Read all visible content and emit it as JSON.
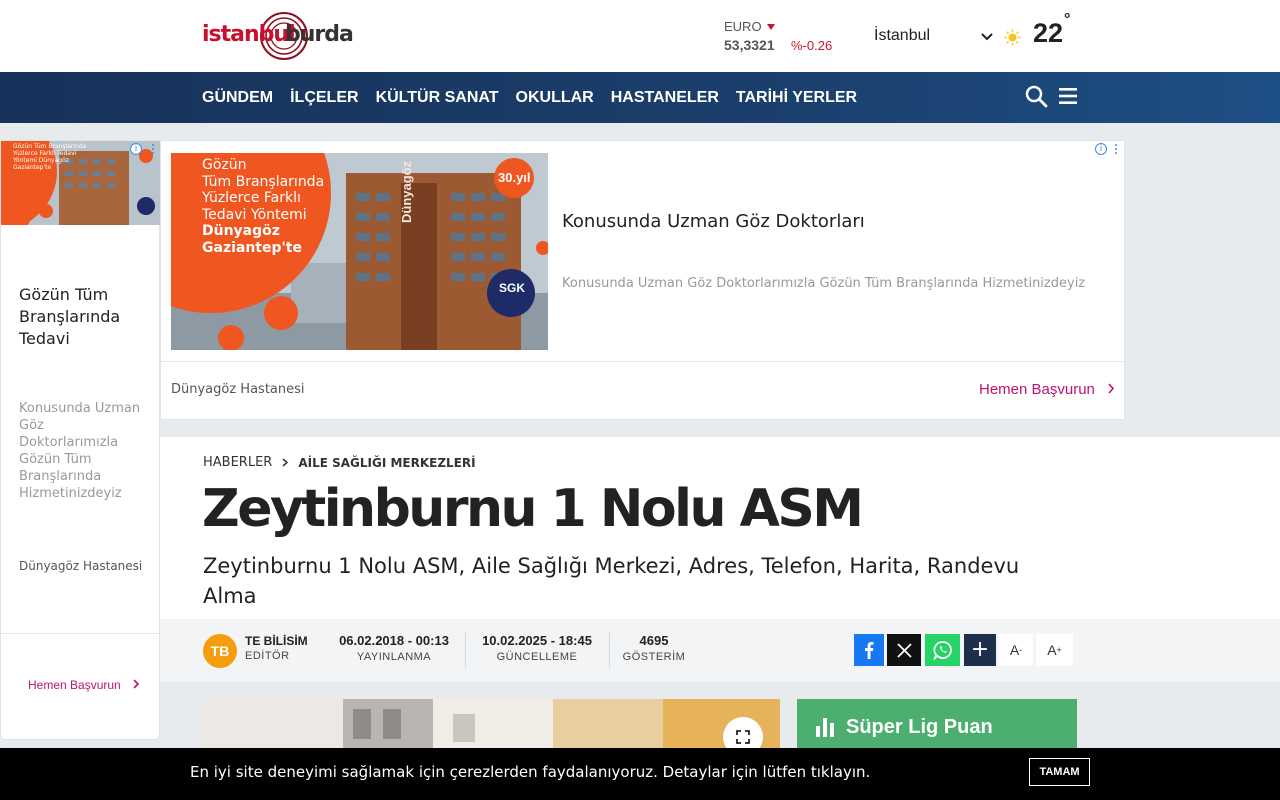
{
  "header": {
    "logo_part1": "istanbul",
    "logo_part2": "burda",
    "currency": {
      "name": "EURO",
      "value": "53,3321",
      "change": "%-0.26",
      "trend": "down"
    },
    "city": "İstanbul",
    "weather_icon": "sun-icon",
    "temperature": "22",
    "degree": "°"
  },
  "nav": {
    "items": [
      "GÜNDEM",
      "İLÇELER",
      "KÜLTÜR SANAT",
      "OKULLAR",
      "HASTANELER",
      "TARİHİ YERLER"
    ],
    "search_icon": "search-icon",
    "menu_icon": "hamburger-menu-icon"
  },
  "side_ad": {
    "title": "Gözün Tüm Branşlarında Tedavi",
    "description": "Konusunda Uzman Göz Doktorlarımızla Gözün Tüm Branşlarında Hizmetinizdeyiz",
    "advertiser": "Dünyagöz Hastanesi",
    "cta": "Hemen Başvurun",
    "image_text": "Gözün Tüm Branşlarında Yüzlerce Farklı Tedavi Yöntemi Dünyagöz Gaziantep'te"
  },
  "banner_ad": {
    "image_lines": [
      "Gözün",
      "Tüm Branşlarında",
      "Yüzlerce Farklı",
      "Tedavi Yöntemi",
      "Dünyagöz",
      "Gaziantep'te"
    ],
    "badge": "30.yıl",
    "sgk_badge": "SGK",
    "building_sign": "Dünyagöz",
    "title": "Konusunda Uzman Göz Doktorları",
    "description": "Konusunda Uzman Göz Doktorlarımızla Gözün Tüm Branşlarında Hizmetinizdeyiz",
    "advertiser": "Dünyagöz Hastanesi",
    "cta": "Hemen Başvurun"
  },
  "article": {
    "breadcrumb": [
      "HABERLER",
      "AİLE SAĞLIĞI MERKEZLERİ"
    ],
    "headline": "Zeytinburnu 1 Nolu ASM",
    "subheadline": "Zeytinburnu 1 Nolu ASM, Aile Sağlığı Merkezi, Adres, Telefon, Harita, Randevu Alma"
  },
  "meta": {
    "avatar_initials": "TB",
    "author": "TE BİLİSİM",
    "role": "EDİTÖR",
    "published": {
      "value": "06.02.2018 - 00:13",
      "label": "YAYINLANMA"
    },
    "updated": {
      "value": "10.02.2025 - 18:45",
      "label": "GÜNCELLEME"
    },
    "views": {
      "value": "4695",
      "label": "GÖSTERİM"
    },
    "font_decrease": "A",
    "font_increase": "A"
  },
  "widget": {
    "title": "Süper Lig Puan"
  },
  "cookie": {
    "text": "En iyi site deneyimi sağlamak için çerezlerden faydalanıyoruz. Detaylar için lütfen tıklayın.",
    "button": "TAMAM"
  },
  "colors": {
    "brand_red": "#c8102e",
    "nav_blue": "#17325a",
    "ad_cta_pink": "#c0136e",
    "facebook": "#1877f2",
    "whatsapp": "#25d366",
    "widget_green": "#4caf6f",
    "avatar_orange": "#f49d0d"
  }
}
